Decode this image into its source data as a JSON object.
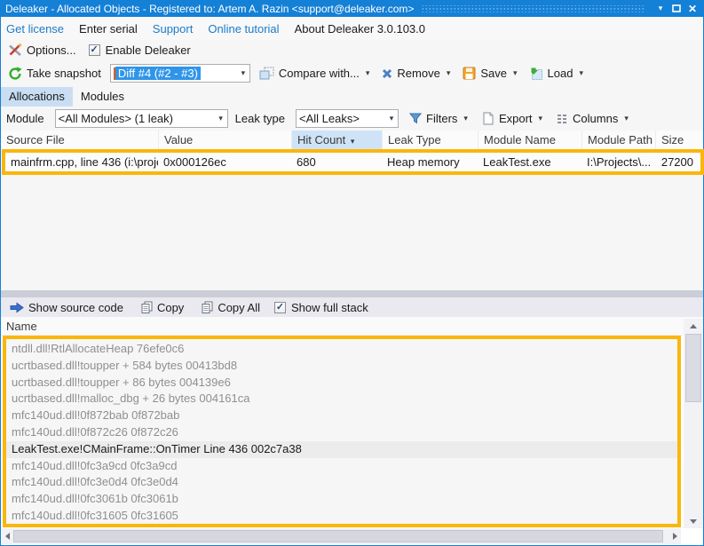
{
  "title_bar": {
    "title": "Deleaker - Allocated Objects - Registered to: Artem A. Razin <support@deleaker.com>"
  },
  "menu": {
    "items": [
      {
        "label": "Get license",
        "link": true
      },
      {
        "label": "Enter serial",
        "link": false
      },
      {
        "label": "Support",
        "link": true
      },
      {
        "label": "Online tutorial",
        "link": true
      },
      {
        "label": "About Deleaker 3.0.103.0",
        "link": false
      }
    ]
  },
  "toolbar_options": {
    "options_label": "Options...",
    "enable_label": "Enable Deleaker",
    "enable_checked": true
  },
  "toolbar_snapshot": {
    "take_snapshot_label": "Take snapshot",
    "snapshot_combo_value": "Diff #4 (#2 - #3)",
    "compare_label": "Compare with...",
    "remove_label": "Remove",
    "save_label": "Save",
    "load_label": "Load"
  },
  "tabs": [
    {
      "label": "Allocations",
      "selected": true
    },
    {
      "label": "Modules",
      "selected": false
    }
  ],
  "filter_bar": {
    "module_label": "Module",
    "module_value": "<All Modules> (1 leak)",
    "leak_type_label": "Leak type",
    "leak_type_value": "<All Leaks>",
    "filters_label": "Filters",
    "export_label": "Export",
    "columns_label": "Columns"
  },
  "allocations_table": {
    "columns": [
      "Source File",
      "Value",
      "Hit Count",
      "Leak Type",
      "Module Name",
      "Module Path",
      "Size"
    ],
    "sorted_column": "Hit Count",
    "sort_direction": "desc",
    "rows": [
      {
        "source_file": "mainfrm.cpp, line 436 (i:\\proje...",
        "value": "0x000126ec",
        "hit_count": "680",
        "leak_type": "Heap memory",
        "module_name": "LeakTest.exe",
        "module_path": "I:\\Projects\\...",
        "size": "27200"
      }
    ]
  },
  "stack_toolbar": {
    "show_source_label": "Show source code",
    "copy_label": "Copy",
    "copy_all_label": "Copy All",
    "show_full_stack_label": "Show full stack",
    "show_full_stack_checked": true
  },
  "stack_panel": {
    "header": "Name",
    "frames": [
      {
        "text": "ntdll.dll!RtlAllocateHeap 76efe0c6",
        "dimmed": true,
        "current": false
      },
      {
        "text": "ucrtbased.dll!toupper + 584 bytes 00413bd8",
        "dimmed": true,
        "current": false
      },
      {
        "text": "ucrtbased.dll!toupper + 86 bytes 004139e6",
        "dimmed": true,
        "current": false
      },
      {
        "text": "ucrtbased.dll!malloc_dbg + 26 bytes 004161ca",
        "dimmed": true,
        "current": false
      },
      {
        "text": "mfc140ud.dll!0f872bab 0f872bab",
        "dimmed": true,
        "current": false
      },
      {
        "text": "mfc140ud.dll!0f872c26 0f872c26",
        "dimmed": true,
        "current": false
      },
      {
        "text": "LeakTest.exe!CMainFrame::OnTimer Line 436 002c7a38",
        "dimmed": false,
        "current": true
      },
      {
        "text": "mfc140ud.dll!0fc3a9cd 0fc3a9cd",
        "dimmed": true,
        "current": false
      },
      {
        "text": "mfc140ud.dll!0fc3e0d4 0fc3e0d4",
        "dimmed": true,
        "current": false
      },
      {
        "text": "mfc140ud.dll!0fc3061b 0fc3061b",
        "dimmed": true,
        "current": false
      },
      {
        "text": "mfc140ud.dll!0fc31605 0fc31605",
        "dimmed": true,
        "current": false
      }
    ]
  },
  "icons": {
    "caret_down": "▾",
    "close": "✕",
    "checkmark": "✓"
  },
  "colors": {
    "titlebar": "#1480D6",
    "link_blue": "#1B7BC8",
    "highlight_border": "#FBB60D",
    "selection_blue": "#3095E9",
    "sorted_column_bg": "#CFE3F7",
    "selected_tab_bg": "#C9DEF2"
  }
}
